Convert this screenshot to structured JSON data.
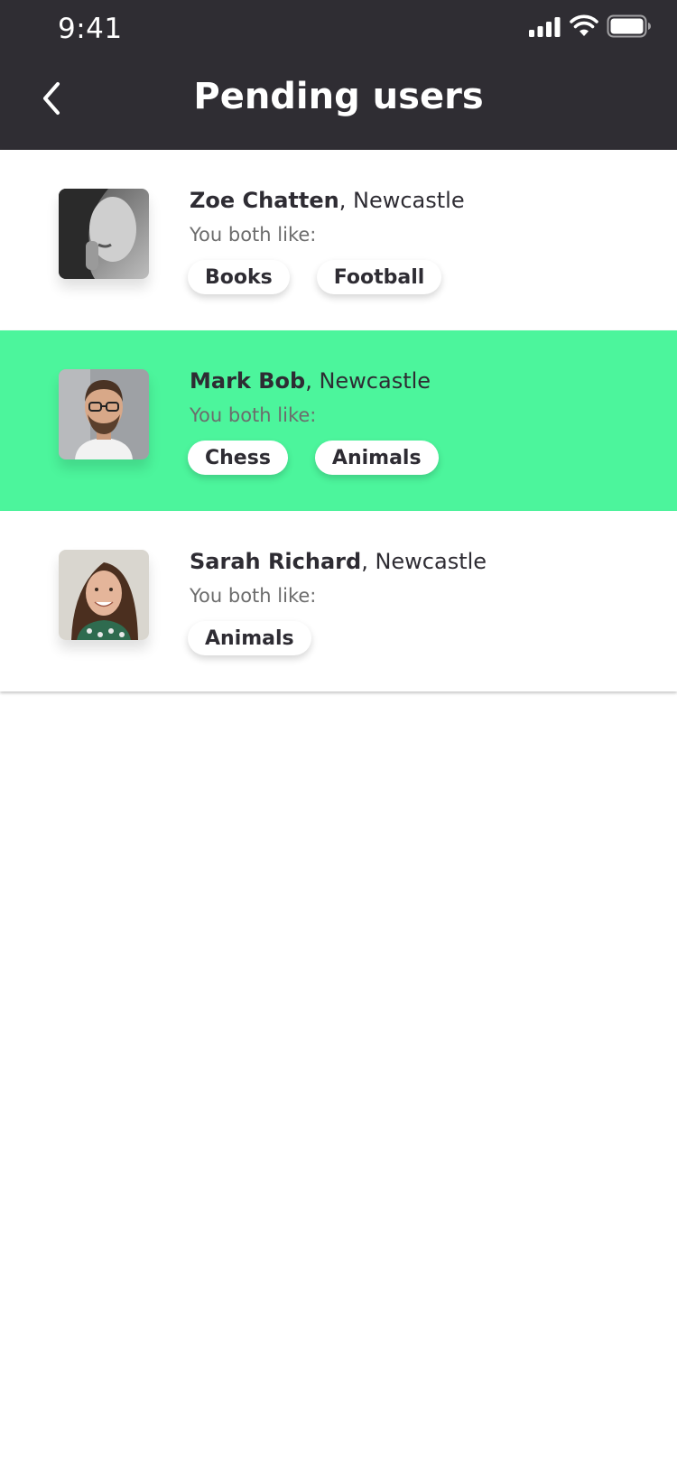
{
  "status_bar": {
    "time": "9:41",
    "icons": [
      "signal-icon",
      "wifi-icon",
      "battery-icon"
    ]
  },
  "header": {
    "title": "Pending users",
    "back_icon": "chevron-left-icon",
    "background": "#2f2d33"
  },
  "users": [
    {
      "name": "Zoe Chatten",
      "location": ", Newcastle",
      "like_label": "You both like:",
      "tags": [
        "Books",
        "Football"
      ],
      "selected": false
    },
    {
      "name": "Mark Bob",
      "location": ", Newcastle",
      "like_label": "You both like:",
      "tags": [
        "Chess",
        "Animals"
      ],
      "selected": true
    },
    {
      "name": "Sarah Richard",
      "location": ", Newcastle",
      "like_label": "You both like:",
      "tags": [
        "Animals"
      ],
      "selected": false
    }
  ],
  "colors": {
    "highlight": "#4cf59c",
    "text": "#2e2c33",
    "muted": "#6c6c6c"
  }
}
